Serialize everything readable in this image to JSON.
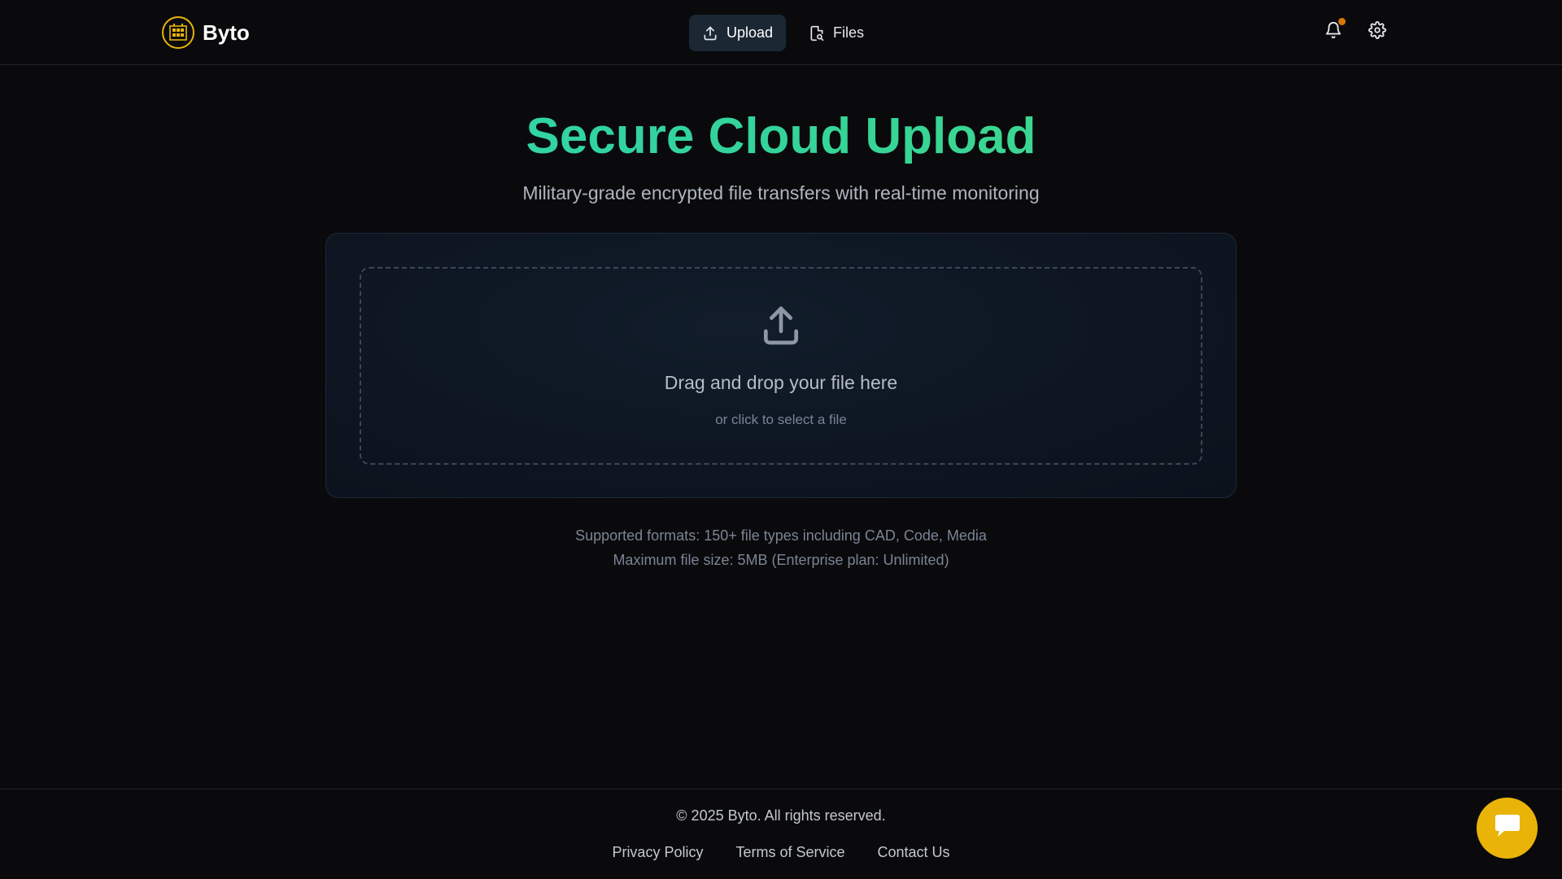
{
  "brand": {
    "name": "Byto",
    "logo_icon": "grid-logo-icon",
    "accent": "#eab308"
  },
  "nav": {
    "tabs": [
      {
        "label": "Upload",
        "icon": "upload-icon",
        "active": true
      },
      {
        "label": "Files",
        "icon": "file-search-icon",
        "active": false
      }
    ]
  },
  "header_actions": {
    "notifications_icon": "bell-icon",
    "settings_icon": "gear-icon",
    "notification_dot_color": "#d97706"
  },
  "hero": {
    "title": "Secure Cloud Upload",
    "subtitle": "Military-grade encrypted file transfers with real-time monitoring",
    "gradient": [
      "#2dd4bf",
      "#4ade80"
    ]
  },
  "dropzone": {
    "icon": "upload-icon",
    "title": "Drag and drop your file here",
    "hint": "or click to select a file"
  },
  "info": {
    "formats": "Supported formats: 150+ file types including CAD, Code, Media",
    "max_size": "Maximum file size: 5MB (Enterprise plan: Unlimited)"
  },
  "footer": {
    "copyright": "© 2025 Byto. All rights reserved.",
    "links": [
      "Privacy Policy",
      "Terms of Service",
      "Contact Us"
    ]
  },
  "chat_button": {
    "icon": "chat-bubble-icon",
    "color": "#eab308"
  }
}
